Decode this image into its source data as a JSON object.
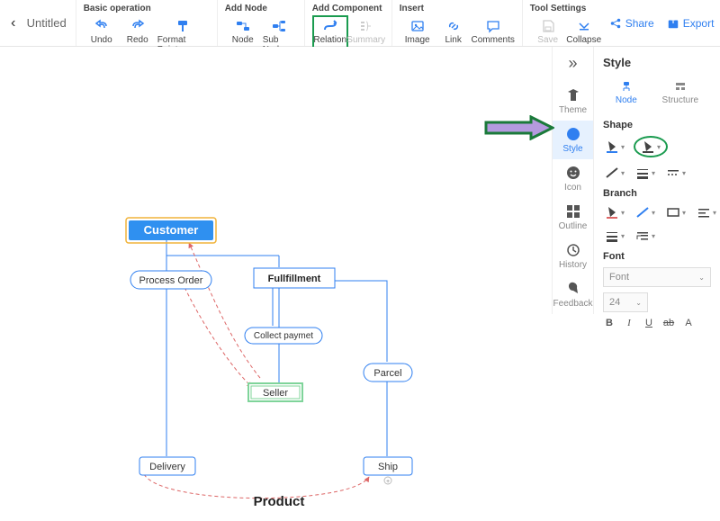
{
  "document_title": "Untitled",
  "ribbon": {
    "basic_operation": {
      "title": "Basic operation",
      "undo": "Undo",
      "redo": "Redo",
      "format_painter": "Format Painter"
    },
    "add_node": {
      "title": "Add Node",
      "node": "Node",
      "sub_node": "Sub Node"
    },
    "add_component": {
      "title": "Add Component",
      "relation": "Relation",
      "summary": "Summary"
    },
    "insert": {
      "title": "Insert",
      "image": "Image",
      "link": "Link",
      "comments": "Comments"
    },
    "tool_settings": {
      "title": "Tool Settings",
      "save": "Save",
      "collapse": "Collapse"
    }
  },
  "top_actions": {
    "share": "Share",
    "export": "Export"
  },
  "rail": {
    "theme": "Theme",
    "style": "Style",
    "icon": "Icon",
    "outline": "Outline",
    "history": "History",
    "feedback": "Feedback"
  },
  "panel": {
    "title": "Style",
    "tabs": {
      "node": "Node",
      "structure": "Structure"
    },
    "shape": "Shape",
    "branch": "Branch",
    "font": "Font",
    "font_select": "Font",
    "font_size": "24",
    "font_btns": {
      "b": "B",
      "i": "I",
      "u": "U",
      "ab": "ab",
      "a": "A"
    }
  },
  "nodes": {
    "customer": "Customer",
    "process_order": "Process Order",
    "fullfillment": "Fullfillment",
    "collect_payment": "Collect paymet",
    "seller": "Seller",
    "parcel": "Parcel",
    "delivery": "Delivery",
    "ship": "Ship",
    "product": "Product"
  }
}
